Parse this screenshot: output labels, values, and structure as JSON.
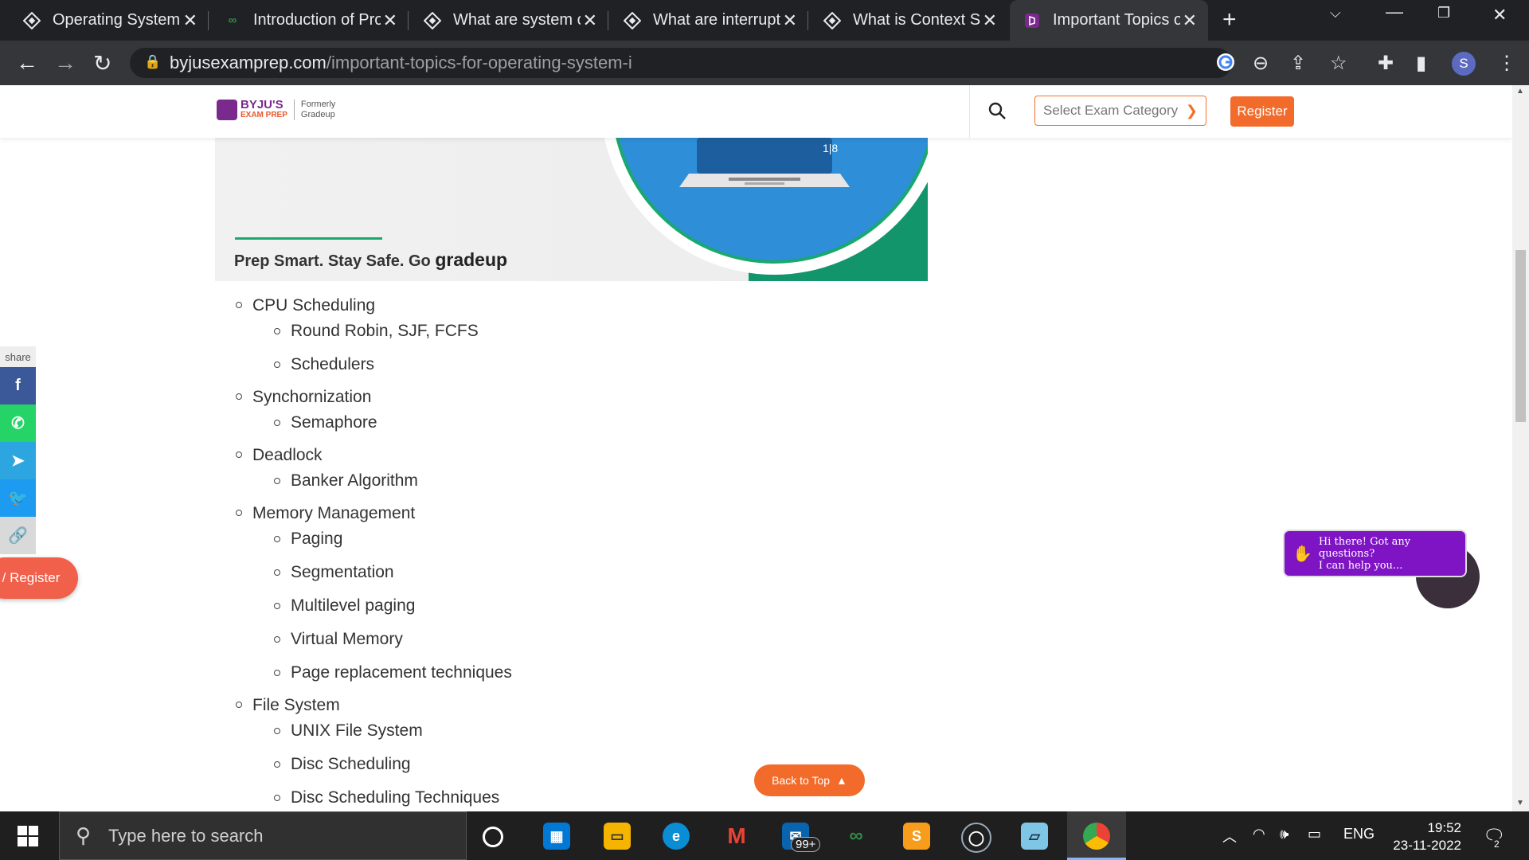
{
  "browser": {
    "tabs": [
      {
        "title": "Operating System -",
        "favicon": "site-diamond-icon",
        "active": false
      },
      {
        "title": "Introduction of Pro",
        "favicon": "gfg-icon",
        "active": false
      },
      {
        "title": "What are system ca",
        "favicon": "site-diamond-icon",
        "active": false
      },
      {
        "title": "What are interrupts",
        "favicon": "site-diamond-icon",
        "active": false
      },
      {
        "title": "What is Context Sw",
        "favicon": "site-diamond-icon",
        "active": false
      },
      {
        "title": "Important Topics of",
        "favicon": "byjus-icon",
        "active": true
      }
    ],
    "url_domain": "byjusexamprep.com",
    "url_path": "/important-topics-for-operating-system-i",
    "profile_initial": "S"
  },
  "site": {
    "logo_brand": "BYJU'S",
    "logo_sub": "EXAM PREP",
    "logo_formerly": "Formerly",
    "logo_formerly_name": "Gradeup",
    "exam_select_placeholder": "Select Exam Category",
    "register_label": "Register"
  },
  "banner": {
    "tagline": "Prep Smart. Stay Safe. Go ",
    "tagline_brand": "gradeup"
  },
  "topics": [
    {
      "label": "CPU Scheduling",
      "subs": [
        "Round Robin, SJF, FCFS",
        "Schedulers"
      ]
    },
    {
      "label": "Synchornization",
      "subs": [
        "Semaphore"
      ]
    },
    {
      "label": "Deadlock",
      "subs": [
        "Banker Algorithm"
      ]
    },
    {
      "label": "Memory Management",
      "subs": [
        "Paging",
        "Segmentation",
        "Multilevel paging",
        "Virtual Memory",
        "Page replacement techniques"
      ]
    },
    {
      "label": "File System",
      "subs": [
        "UNIX File System",
        "Disc Scheduling",
        "Disc Scheduling Techniques"
      ]
    }
  ],
  "share": {
    "label": "share",
    "buttons": [
      {
        "name": "facebook-share-icon",
        "color": "#3b5998",
        "glyph": "f"
      },
      {
        "name": "whatsapp-share-icon",
        "color": "#25d366",
        "glyph": "✆"
      },
      {
        "name": "telegram-share-icon",
        "color": "#2ca5e0",
        "glyph": "➤"
      },
      {
        "name": "twitter-share-icon",
        "color": "#1d9bf0",
        "glyph": "🐦"
      },
      {
        "name": "copy-link-icon",
        "color": "#d9d9d9",
        "glyph": "🔗"
      }
    ]
  },
  "floating": {
    "left_register": "/ Register",
    "back_to_top": "Back to Top",
    "chat_line1": "Hi there! Got any questions?",
    "chat_line2": "I can help you..."
  },
  "taskbar": {
    "search_placeholder": "Type here to search",
    "mail_badge": "99+",
    "lang": "ENG",
    "time": "19:52",
    "date": "23-11-2022",
    "notifications": "2"
  },
  "colors": {
    "accent_orange": "#f26b2a",
    "byjus_purple": "#7a2a8c",
    "chat_purple": "#7e14c4"
  }
}
